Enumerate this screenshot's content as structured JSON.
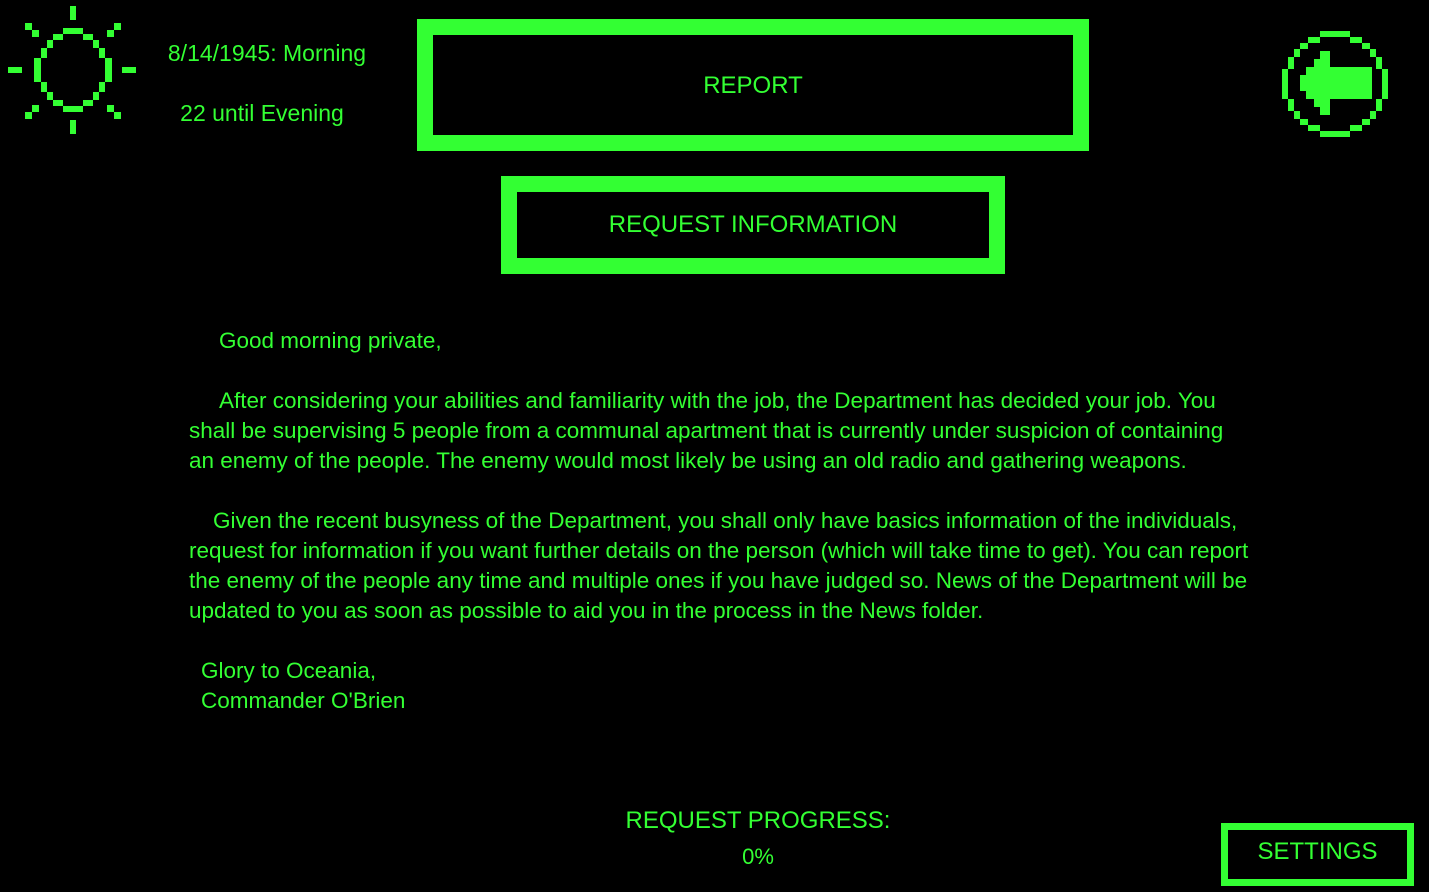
{
  "colors": {
    "background": "#000000",
    "accent": "#33ff33"
  },
  "status": {
    "time_of_day_icon": "sun-icon",
    "date_time": "8/14/1945: Morning",
    "time_remaining": "22 until Evening"
  },
  "buttons": {
    "report_label": "REPORT",
    "request_info_label": "REQUEST INFORMATION",
    "settings_label": "SETTINGS",
    "back_icon": "back-arrow-icon"
  },
  "letter": {
    "greeting": "Good morning private,",
    "paragraph_1": "After considering your abilities and familiarity with the job, the Department has decided your job. You shall be supervising 5 people from a communal apartment that is currently under suspicion of containing an enemy of the people. The enemy would most likely be using an old radio and gathering weapons.",
    "paragraph_2": "Given the recent busyness of the Department, you shall only have basics information of the individuals, request for information if you want further details on the person (which will take time to get). You can report the enemy of the people any time and multiple ones if you have judged so. News of the Department will be updated to you as soon as possible to aid you in the process in the News folder.",
    "closing": "Glory to Oceania,",
    "signature": "Commander O'Brien"
  },
  "progress": {
    "label": "REQUEST PROGRESS:",
    "value": "0%"
  }
}
